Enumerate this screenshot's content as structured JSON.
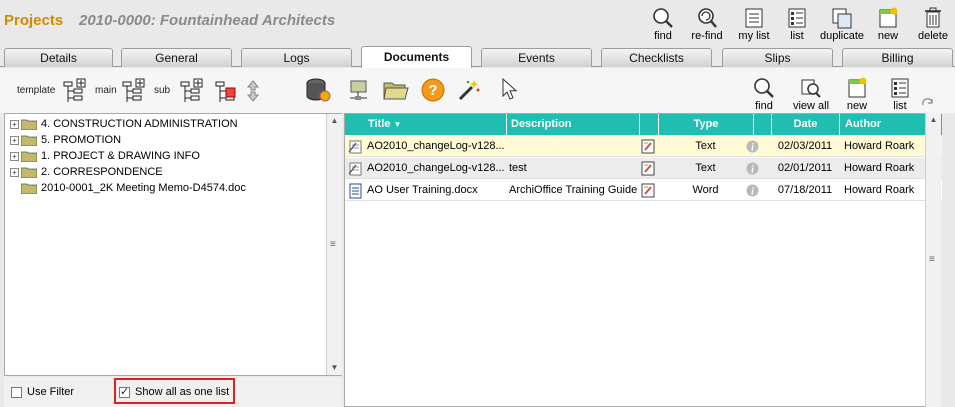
{
  "header": {
    "app_name": "Projects",
    "record_title": "2010-0000: Fountainhead Architects"
  },
  "top_toolbar": [
    {
      "label": "find",
      "icon": "magnifier-icon"
    },
    {
      "label": "re-find",
      "icon": "refind-icon"
    },
    {
      "label": "my list",
      "icon": "my-list-icon"
    },
    {
      "label": "list",
      "icon": "list-icon"
    },
    {
      "label": "duplicate",
      "icon": "duplicate-icon"
    },
    {
      "label": "new",
      "icon": "new-icon"
    },
    {
      "label": "delete",
      "icon": "trash-icon"
    }
  ],
  "tabs": [
    "Details",
    "General",
    "Logs",
    "Documents",
    "Events",
    "Checklists",
    "Slips",
    "Billing"
  ],
  "active_tab": "Documents",
  "doc_toolbar": {
    "template": "template",
    "main": "main",
    "sub": "sub"
  },
  "right_toolbar": {
    "find": "find",
    "view_all": "view all",
    "new": "new",
    "list": "list"
  },
  "tree": [
    {
      "label": "4. CONSTRUCTION ADMINISTRATION",
      "type": "folder"
    },
    {
      "label": "5. PROMOTION",
      "type": "folder"
    },
    {
      "label": "1. PROJECT & DRAWING INFO",
      "type": "folder"
    },
    {
      "label": "2. CORRESPONDENCE",
      "type": "folder"
    },
    {
      "label": "2010-0001_2K Meeting Memo-D4574.doc",
      "type": "file"
    }
  ],
  "filters": {
    "use_filter": "Use Filter",
    "show_all": "Show all as one list"
  },
  "table": {
    "headers": {
      "title": "Title",
      "description": "Description",
      "type": "Type",
      "date": "Date",
      "author": "Author"
    },
    "rows": [
      {
        "title": "AO2010_changeLog-v128...",
        "description": "",
        "type": "Text",
        "date": "02/03/2011",
        "author": "Howard Roark"
      },
      {
        "title": "AO2010_changeLog-v128...",
        "description": "test",
        "type": "Text",
        "date": "02/01/2011",
        "author": "Howard Roark"
      },
      {
        "title": "AO User Training.docx",
        "description": "ArchiOffice Training Guide",
        "type": "Word",
        "date": "07/18/2011",
        "author": "Howard Roark"
      }
    ]
  },
  "colors": {
    "table_header": "#1fbeb0",
    "selected_row": "#fffbd6",
    "app_name": "#d08a00",
    "highlight": "#e02020"
  }
}
